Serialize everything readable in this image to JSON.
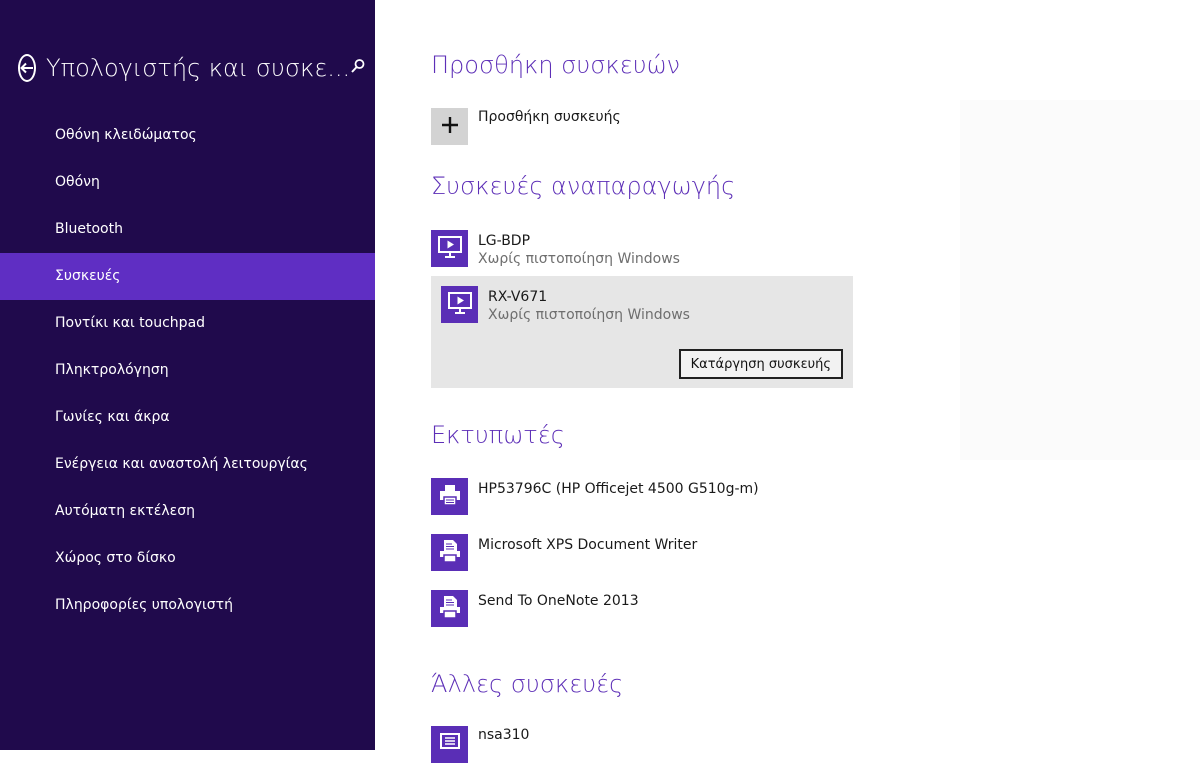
{
  "sidebar": {
    "title": "Υπολογιστής και συσκε...",
    "items": [
      {
        "label": "Οθόνη κλειδώματος"
      },
      {
        "label": "Οθόνη"
      },
      {
        "label": "Bluetooth"
      },
      {
        "label": "Συσκευές",
        "active": true
      },
      {
        "label": "Ποντίκι και touchpad"
      },
      {
        "label": "Πληκτρολόγηση"
      },
      {
        "label": "Γωνίες και άκρα"
      },
      {
        "label": "Ενέργεια και αναστολή λειτουργίας"
      },
      {
        "label": "Αυτόματη εκτέλεση"
      },
      {
        "label": "Χώρος στο δίσκο"
      },
      {
        "label": "Πληροφορίες υπολογιστή"
      }
    ]
  },
  "add_section": {
    "heading": "Προσθήκη συσκευών",
    "add_label": "Προσθήκη συσκευής"
  },
  "playback_section": {
    "heading": "Συσκευές αναπαραγωγής",
    "devices": [
      {
        "name": "LG-BDP",
        "status": "Χωρίς πιστοποίηση Windows"
      },
      {
        "name": "RX-V671",
        "status": "Χωρίς πιστοποίηση Windows"
      }
    ],
    "remove_label": "Κατάργηση συσκευής"
  },
  "printers_section": {
    "heading": "Εκτυπωτές",
    "devices": [
      {
        "name": "HP53796C (HP Officejet 4500 G510g-m)"
      },
      {
        "name": "Microsoft XPS Document Writer"
      },
      {
        "name": "Send To OneNote 2013"
      }
    ]
  },
  "other_section": {
    "heading": "Άλλες συσκευές",
    "devices": [
      {
        "name": "nsa310"
      }
    ]
  },
  "colors": {
    "sidebar_bg": "#200a4c",
    "sidebar_active": "#5f2ec3",
    "accent": "#5a2eb6",
    "heading": "#5d2fb7"
  },
  "icons": {
    "back": "back-arrow-icon",
    "search": "search-icon",
    "add": "plus-icon",
    "media": "monitor-play-icon",
    "printer": "printer-icon",
    "document_printer": "document-printer-icon",
    "other": "device-icon"
  }
}
